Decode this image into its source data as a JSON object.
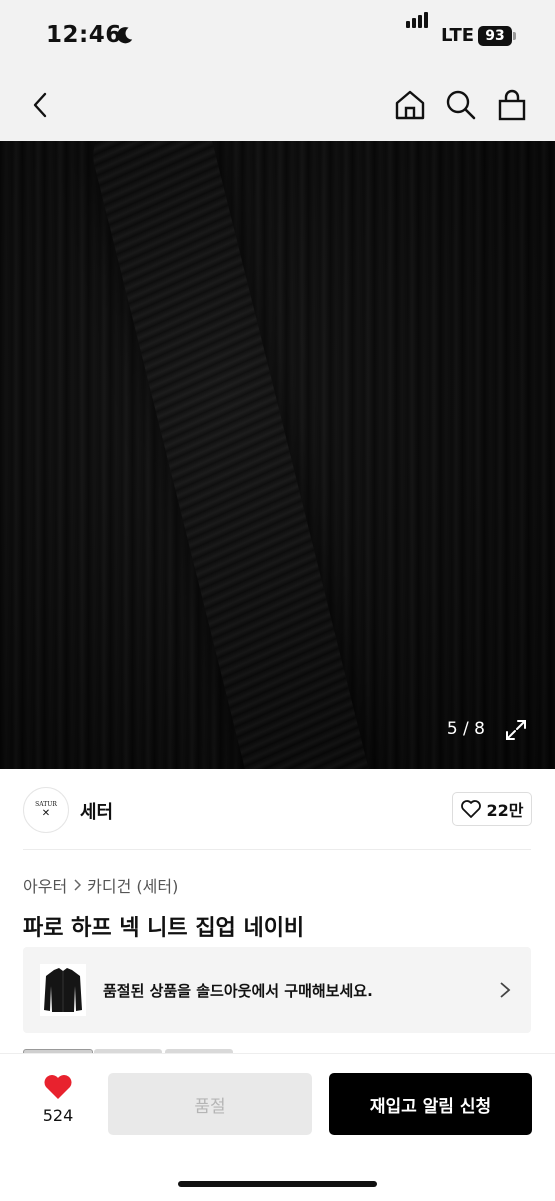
{
  "status_bar": {
    "time": "12:46",
    "network": "LTE",
    "battery": "93"
  },
  "nav": {
    "icons": [
      "back-icon",
      "home-icon",
      "search-icon",
      "shopping-bag-icon"
    ]
  },
  "gallery": {
    "counter": "5 / 8",
    "current": 5,
    "total": 8
  },
  "brand": {
    "logo_text_top": "SATUR",
    "logo_text_bottom": "✕",
    "name": "세터",
    "like_count": "22만"
  },
  "breadcrumb": {
    "items": [
      "아우터",
      "카디건 (세터)"
    ]
  },
  "product": {
    "title": "파로 하프 넥 니트 집업 네이비"
  },
  "soldout_banner": {
    "text": "품절된 상품을 솔드아웃에서 구매해보세요."
  },
  "bottom_bar": {
    "wish_count": "524",
    "soldout_label": "품절",
    "restock_label": "재입고 알림 신청"
  },
  "colors": {
    "heart": "#e8222e",
    "primary_button": "#000000",
    "disabled_button": "#e9e9e9"
  }
}
